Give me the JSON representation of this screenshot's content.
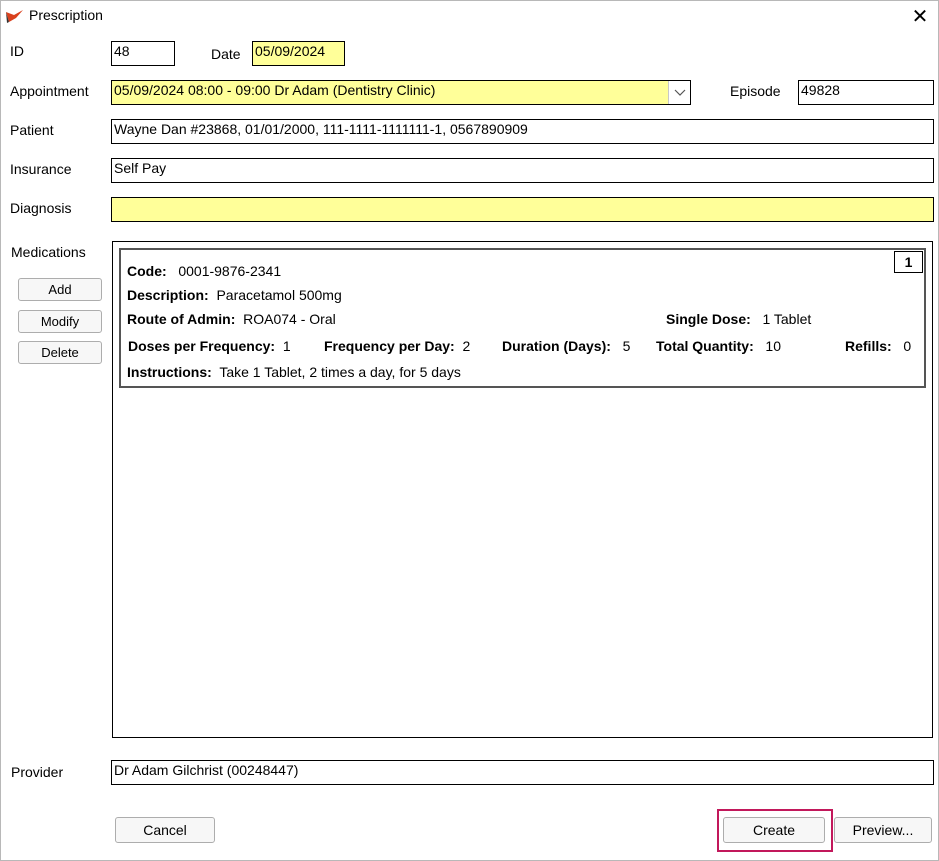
{
  "window": {
    "title": "Prescription"
  },
  "form": {
    "id_label": "ID",
    "id_value": "48",
    "date_label": "Date",
    "date_value": "05/09/2024",
    "appointment_label": "Appointment",
    "appointment_value": "05/09/2024 08:00 - 09:00 Dr Adam (Dentistry Clinic)",
    "episode_label": "Episode",
    "episode_value": "49828",
    "patient_label": "Patient",
    "patient_value": "Wayne Dan  #23868, 01/01/2000, 111-1111-1111111-1, 0567890909",
    "insurance_label": "Insurance",
    "insurance_value": "Self Pay",
    "diagnosis_label": "Diagnosis",
    "diagnosis_value": "",
    "medications_label": "Medications",
    "provider_label": "Provider",
    "provider_value": "Dr Adam Gilchrist (00248447)"
  },
  "med_buttons": {
    "add": "Add",
    "modify": "Modify",
    "delete": "Delete"
  },
  "medication": {
    "number": "1",
    "code_label": "Code:",
    "code": "0001-9876-2341",
    "description_label": "Description:",
    "description": "Paracetamol 500mg",
    "route_label": "Route of Admin:",
    "route": "ROA074 - Oral",
    "single_dose_label": "Single Dose:",
    "single_dose": "1 Tablet",
    "doses_per_freq_label": "Doses per Frequency:",
    "doses_per_freq": "1",
    "freq_per_day_label": "Frequency per Day:",
    "freq_per_day": "2",
    "duration_label": "Duration (Days):",
    "duration": "5",
    "total_qty_label": "Total Quantity:",
    "total_qty": "10",
    "refills_label": "Refills:",
    "refills": "0",
    "instructions_label": "Instructions:",
    "instructions": "Take 1 Tablet, 2 times a day, for 5 days"
  },
  "footer": {
    "cancel": "Cancel",
    "create": "Create",
    "preview": "Preview..."
  },
  "colors": {
    "required_field": "#ffff99",
    "highlight": "#c2185b",
    "app_icon": "#d9411e"
  },
  "icons": {
    "app": "prescription-app-icon",
    "close": "close-icon",
    "dropdown": "chevron-down-icon"
  }
}
